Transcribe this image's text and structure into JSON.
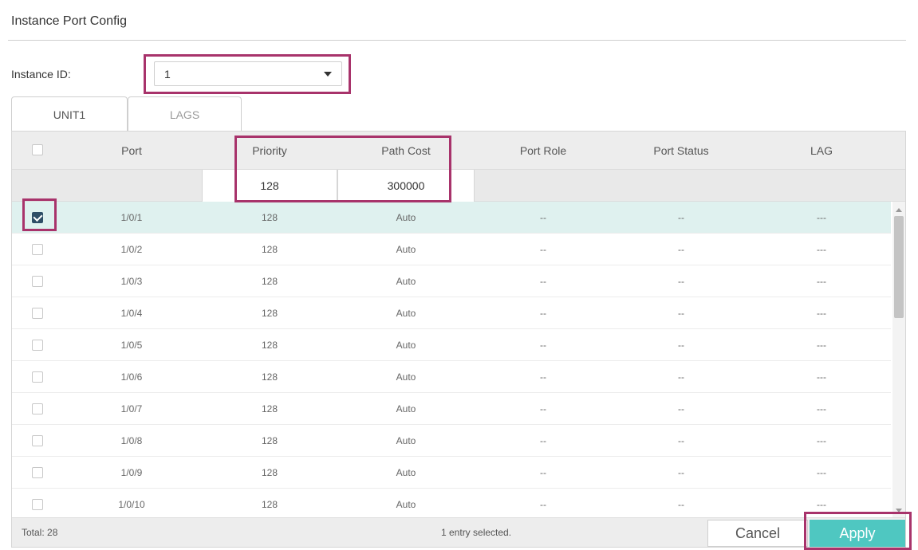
{
  "title": "Instance Port Config",
  "instance": {
    "label": "Instance ID:",
    "value": "1"
  },
  "tabs": [
    {
      "label": "UNIT1",
      "active": true
    },
    {
      "label": "LAGS",
      "active": false
    }
  ],
  "columns": {
    "port": "Port",
    "priority": "Priority",
    "path_cost": "Path Cost",
    "port_role": "Port Role",
    "port_status": "Port Status",
    "lag": "LAG"
  },
  "edit_row": {
    "priority": "128",
    "path_cost": "300000"
  },
  "rows": [
    {
      "port": "1/0/1",
      "priority": "128",
      "path_cost": "Auto",
      "port_role": "--",
      "port_status": "--",
      "lag": "---",
      "checked": true
    },
    {
      "port": "1/0/2",
      "priority": "128",
      "path_cost": "Auto",
      "port_role": "--",
      "port_status": "--",
      "lag": "---",
      "checked": false
    },
    {
      "port": "1/0/3",
      "priority": "128",
      "path_cost": "Auto",
      "port_role": "--",
      "port_status": "--",
      "lag": "---",
      "checked": false
    },
    {
      "port": "1/0/4",
      "priority": "128",
      "path_cost": "Auto",
      "port_role": "--",
      "port_status": "--",
      "lag": "---",
      "checked": false
    },
    {
      "port": "1/0/5",
      "priority": "128",
      "path_cost": "Auto",
      "port_role": "--",
      "port_status": "--",
      "lag": "---",
      "checked": false
    },
    {
      "port": "1/0/6",
      "priority": "128",
      "path_cost": "Auto",
      "port_role": "--",
      "port_status": "--",
      "lag": "---",
      "checked": false
    },
    {
      "port": "1/0/7",
      "priority": "128",
      "path_cost": "Auto",
      "port_role": "--",
      "port_status": "--",
      "lag": "---",
      "checked": false
    },
    {
      "port": "1/0/8",
      "priority": "128",
      "path_cost": "Auto",
      "port_role": "--",
      "port_status": "--",
      "lag": "---",
      "checked": false
    },
    {
      "port": "1/0/9",
      "priority": "128",
      "path_cost": "Auto",
      "port_role": "--",
      "port_status": "--",
      "lag": "---",
      "checked": false
    },
    {
      "port": "1/0/10",
      "priority": "128",
      "path_cost": "Auto",
      "port_role": "--",
      "port_status": "--",
      "lag": "---",
      "checked": false
    }
  ],
  "footer": {
    "total": "Total: 28",
    "selection": "1 entry selected."
  },
  "buttons": {
    "cancel": "Cancel",
    "apply": "Apply"
  },
  "colors": {
    "accent": "#4fc7c1",
    "highlight": "#a8336b",
    "selected_row": "#dff1ef"
  }
}
